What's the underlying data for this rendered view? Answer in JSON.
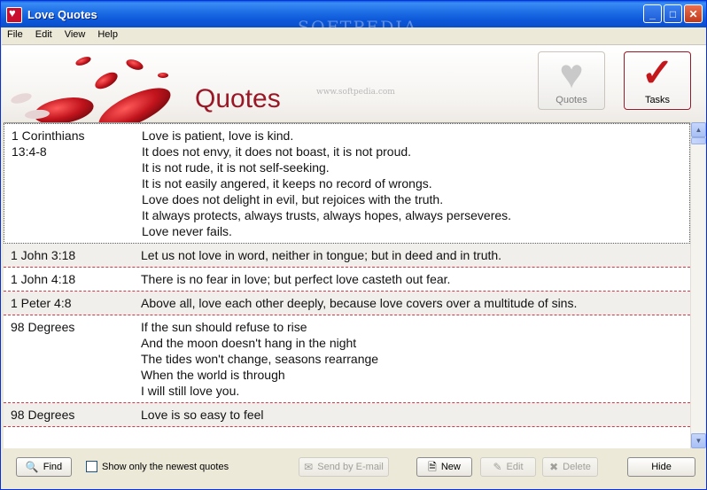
{
  "window": {
    "title": "Love Quotes"
  },
  "watermark": {
    "text": "SOFTPEDIA",
    "sub": "www.softpedia.com"
  },
  "menu": [
    "File",
    "Edit",
    "View",
    "Help"
  ],
  "header": {
    "page_title": "Quotes",
    "quotes_button": "Quotes",
    "tasks_button": "Tasks"
  },
  "quotes": [
    {
      "author": "1 Corinthians\n13:4-8",
      "text": "Love is patient, love is kind.\nIt does not envy, it does not boast, it is not proud.\nIt is not rude, it is not self-seeking.\nIt is not easily angered, it keeps no record of wrongs.\nLove does not delight in evil, but rejoices with the truth.\nIt always protects, always trusts, always hopes, always perseveres.\nLove never fails."
    },
    {
      "author": "1 John 3:18",
      "text": "Let us not love in word, neither in tongue; but in deed and in truth."
    },
    {
      "author": "1 John 4:18",
      "text": "There is no fear in love; but perfect love casteth out fear."
    },
    {
      "author": "1 Peter 4:8",
      "text": "Above all, love each other deeply, because love covers over a multitude of sins."
    },
    {
      "author": "98 Degrees",
      "text": "If the sun should refuse to rise\nAnd the moon doesn't hang in the night\nThe tides won't change, seasons rearrange\nWhen the world is through\nI will still love you."
    },
    {
      "author": "98 Degrees",
      "text": "Love is so easy to feel"
    }
  ],
  "bottom": {
    "find": "Find",
    "newest_label": "Show only the newest quotes",
    "send_email": "Send by E-mail",
    "new": "New",
    "edit": "Edit",
    "delete": "Delete",
    "hide": "Hide"
  }
}
